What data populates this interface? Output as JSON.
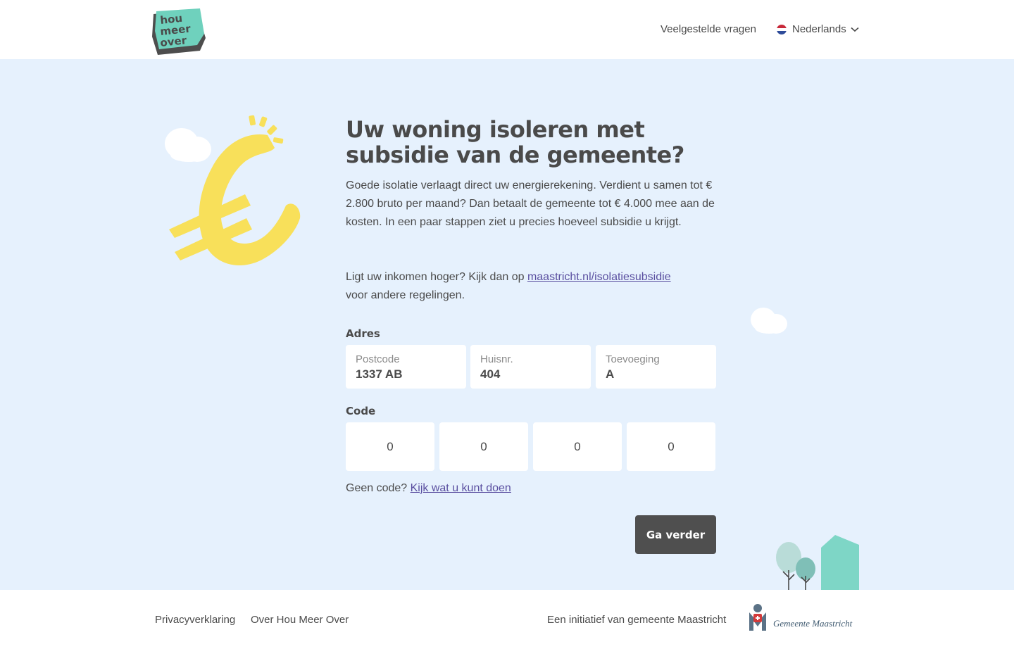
{
  "header": {
    "logo_text": [
      "hou",
      "meer",
      "over"
    ],
    "faq_label": "Veelgestelde vragen",
    "language_label": "Nederlands"
  },
  "hero": {
    "title": "Uw woning isoleren met subsidie van de gemeente?",
    "intro": "Goede isolatie verlaagt direct uw energierekening. Verdient u samen tot € 2.800 bruto per maand? Dan betaalt de gemeente tot € 4.000 mee aan de kosten. In een paar stappen ziet u precies hoeveel subsidie u krijgt.",
    "income_text": "Ligt uw inkomen hoger? Kijk dan op ",
    "income_link": "maastricht.nl/isolatiesubsidie",
    "income_suffix": "voor andere regelingen."
  },
  "form": {
    "address_label": "Adres",
    "postcode": {
      "placeholder": "Postcode",
      "value": "1337 AB"
    },
    "house_number": {
      "placeholder": "Huisnr.",
      "value": "404"
    },
    "addition": {
      "placeholder": "Toevoeging",
      "value": "A"
    },
    "code_label": "Code",
    "code_digits": [
      "0",
      "0",
      "0",
      "0"
    ],
    "no_code_text": "Geen code? ",
    "no_code_link": "Kijk wat u kunt doen",
    "submit_label": "Ga verder"
  },
  "footer": {
    "privacy": "Privacyverklaring",
    "about": "Over Hou Meer Over",
    "initiative": "Een initiatief van gemeente Maastricht",
    "municipality_logo_text": "Gemeente Maastricht"
  },
  "colors": {
    "hero_bg": "#e6f1fd",
    "accent_yellow": "#f8e05a",
    "logo_teal": "#6fd1bd",
    "button_dark": "#4f4f4f",
    "link": "#5a4fa0"
  }
}
